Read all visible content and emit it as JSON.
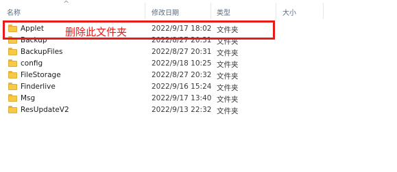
{
  "columns": {
    "name": "名称",
    "date": "修改日期",
    "type": "类型",
    "size": "大小"
  },
  "files": [
    {
      "name": "Applet",
      "date": "2022/9/17 18:02",
      "type": "文件夹",
      "selected": true
    },
    {
      "name": "Backup",
      "date": "2022/8/27 20:31",
      "type": "文件夹"
    },
    {
      "name": "BackupFiles",
      "date": "2022/8/27 20:31",
      "type": "文件夹"
    },
    {
      "name": "config",
      "date": "2022/9/18 10:25",
      "type": "文件夹"
    },
    {
      "name": "FileStorage",
      "date": "2022/8/27 20:32",
      "type": "文件夹"
    },
    {
      "name": "Finderlive",
      "date": "2022/9/16 15:24",
      "type": "文件夹"
    },
    {
      "name": "Msg",
      "date": "2022/9/17 13:40",
      "type": "文件夹"
    },
    {
      "name": "ResUpdateV2",
      "date": "2022/9/13 22:32",
      "type": "文件夹"
    }
  ],
  "annotation": {
    "text": "删除此文件夹",
    "color": "#e81b1b"
  },
  "colors": {
    "selection": "#cce8ff",
    "folder": "#f7c948"
  }
}
